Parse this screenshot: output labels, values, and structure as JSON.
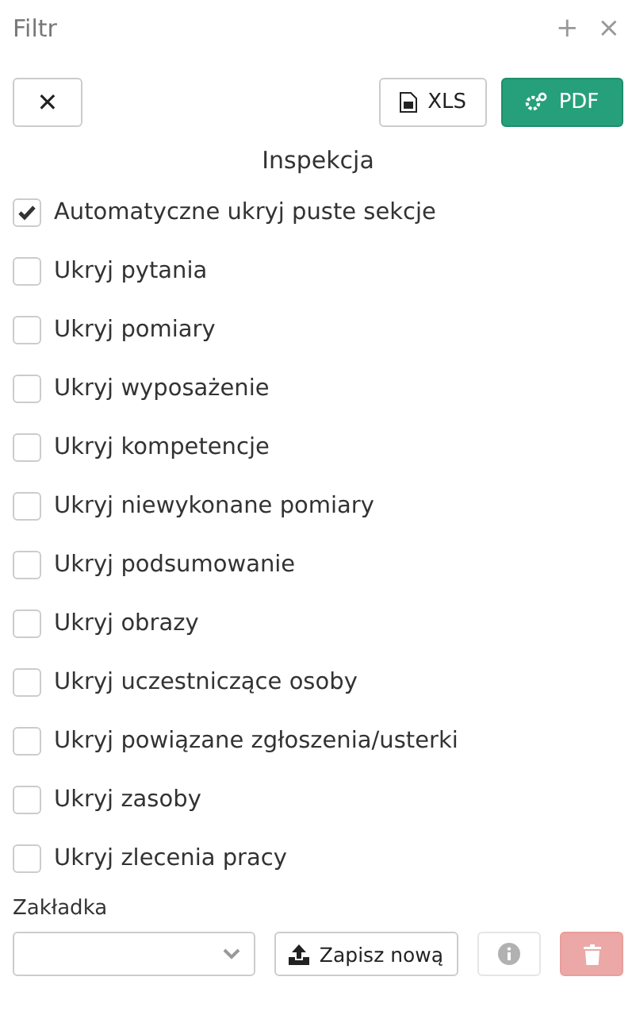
{
  "panel": {
    "title": "Filtr",
    "header_actions": [
      "+",
      "×"
    ]
  },
  "toolbar": {
    "clear": {
      "label": "✕"
    },
    "xls": {
      "label": "XLS"
    },
    "pdf": {
      "label": "PDF"
    }
  },
  "section": {
    "title": "Inspekcja"
  },
  "options": [
    {
      "label": "Automatyczne ukryj puste sekcje",
      "checked": true
    },
    {
      "label": "Ukryj pytania",
      "checked": false
    },
    {
      "label": "Ukryj pomiary",
      "checked": false
    },
    {
      "label": "Ukryj wyposażenie",
      "checked": false
    },
    {
      "label": "Ukryj kompetencje",
      "checked": false
    },
    {
      "label": "Ukryj niewykonane pomiary",
      "checked": false
    },
    {
      "label": "Ukryj podsumowanie",
      "checked": false
    },
    {
      "label": "Ukryj obrazy",
      "checked": false
    },
    {
      "label": "Ukryj uczestniczące osoby",
      "checked": false
    },
    {
      "label": "Ukryj powiązane zgłoszenia/usterki",
      "checked": false
    },
    {
      "label": "Ukryj zasoby",
      "checked": false
    },
    {
      "label": "Ukryj zlecenia pracy",
      "checked": false
    }
  ],
  "bookmark": {
    "label": "Zakładka",
    "save_label": "Zapisz nową",
    "info_disabled": true,
    "delete_disabled": true
  }
}
